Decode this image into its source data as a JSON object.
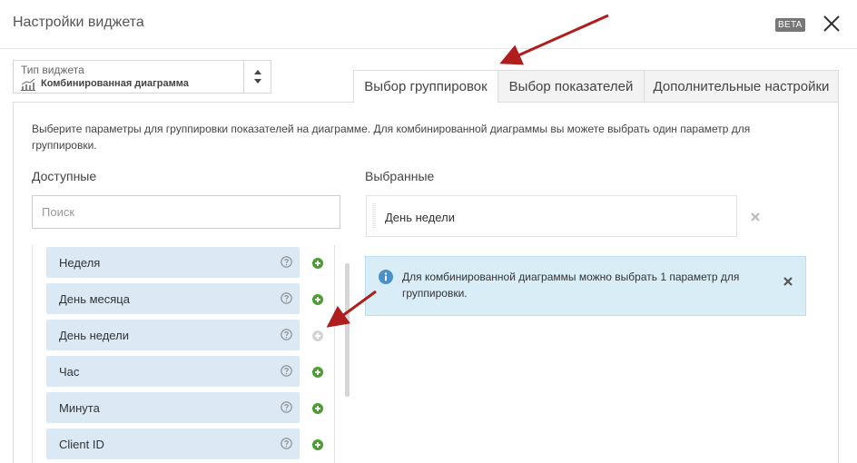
{
  "header": {
    "title": "Настройки виджета",
    "beta": "BETA",
    "close_icon": "close-icon"
  },
  "widget_type": {
    "label": "Тип виджета",
    "value": "Комбинированная диаграмма",
    "icon": "chart-icon"
  },
  "tabs": [
    {
      "label": "Выбор группировок",
      "active": true
    },
    {
      "label": "Выбор показателей",
      "active": false
    },
    {
      "label": "Дополнительные настройки",
      "active": false
    }
  ],
  "description": "Выберите параметры для группировки показателей на диаграмме. Для комбинированной диаграммы вы можете выбрать один параметр для группировки.",
  "available": {
    "heading": "Доступные",
    "search_placeholder": "Поиск",
    "items": [
      {
        "label": "Неделя",
        "addable": true
      },
      {
        "label": "День месяца",
        "addable": true
      },
      {
        "label": "День недели",
        "addable": false
      },
      {
        "label": "Час",
        "addable": true
      },
      {
        "label": "Минута",
        "addable": true
      },
      {
        "label": "Client ID",
        "addable": true
      }
    ]
  },
  "selected": {
    "heading": "Выбранные",
    "items": [
      {
        "label": "День недели"
      }
    ]
  },
  "info": {
    "text": "Для комбинированной диаграммы можно выбрать 1 параметр для группировки."
  },
  "colors": {
    "item_bg": "#dbe9f5",
    "add_green": "#4a9d2f",
    "info_bg": "#d9edf7",
    "info_icon": "#4a90c9",
    "annotation_arrow": "#b01d1d"
  }
}
